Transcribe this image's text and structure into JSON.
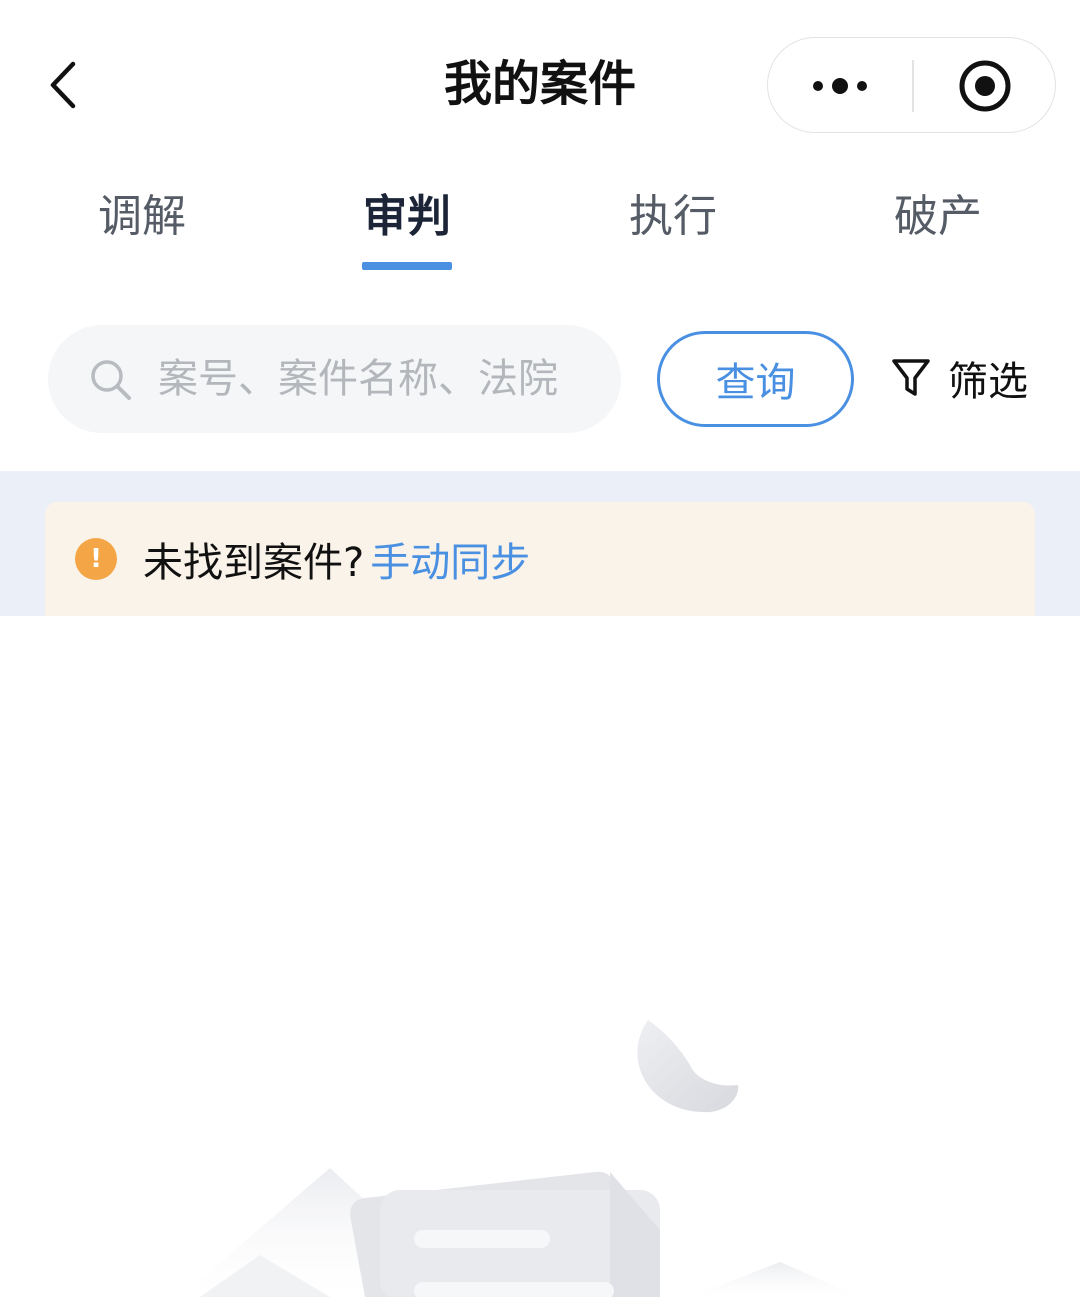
{
  "nav": {
    "title": "我的案件",
    "back_icon": "chevron-left-icon",
    "more_icon": "more-dots-icon",
    "close_icon": "target-close-icon"
  },
  "tabs": [
    {
      "label": "调解",
      "active": false
    },
    {
      "label": "审判",
      "active": true
    },
    {
      "label": "执行",
      "active": false
    },
    {
      "label": "破产",
      "active": false
    }
  ],
  "search": {
    "placeholder": "案号、案件名称、法院",
    "value": "",
    "icon": "search-icon",
    "query_label": "查询",
    "filter_label": "筛选",
    "filter_icon": "funnel-icon"
  },
  "notice": {
    "icon": "warning-icon",
    "icon_glyph": "!",
    "text": "未找到案件?",
    "link": "手动同步"
  },
  "colors": {
    "accent": "#4a90e2",
    "warning": "#f4a646",
    "notice_bg": "#faf3ea",
    "band_bg": "#ebf0f8"
  }
}
